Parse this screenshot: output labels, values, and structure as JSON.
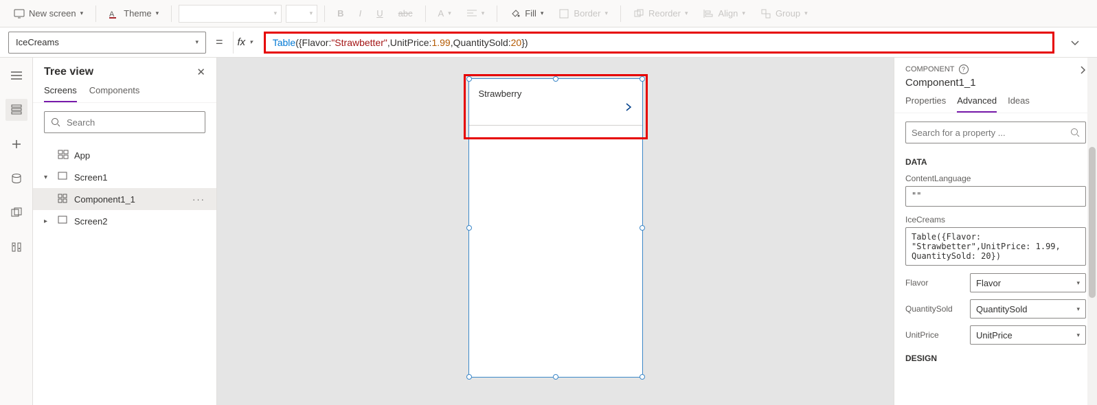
{
  "toolbar": {
    "new_screen": "New screen",
    "theme": "Theme",
    "bold": "B",
    "italic": "I",
    "underline": "U",
    "strike": "abc",
    "font_color": "A",
    "fill": "Fill",
    "border": "Border",
    "reorder": "Reorder",
    "align": "Align",
    "group": "Group"
  },
  "formula": {
    "property": "IceCreams",
    "fn": "Table",
    "id1": "Flavor",
    "str1": "\"Strawbetter\"",
    "id2": "UnitPrice",
    "num1": "1.99",
    "id3": "QuantitySold",
    "num2": "20"
  },
  "tree": {
    "title": "Tree view",
    "tab_screens": "Screens",
    "tab_components": "Components",
    "search_ph": "Search",
    "app": "App",
    "screen1": "Screen1",
    "component1": "Component1_1",
    "screen2": "Screen2"
  },
  "canvas": {
    "item_text": "Strawberry"
  },
  "right": {
    "type": "COMPONENT",
    "name": "Component1_1",
    "tab_props": "Properties",
    "tab_adv": "Advanced",
    "tab_ideas": "Ideas",
    "search_ph": "Search for a property ...",
    "section_data": "DATA",
    "content_lang_lbl": "ContentLanguage",
    "content_lang_val": "\"\"",
    "icecreams_lbl": "IceCreams",
    "icecreams_val": "Table({Flavor: \"Strawbetter\",UnitPrice: 1.99, QuantitySold: 20})",
    "flavor_lbl": "Flavor",
    "flavor_val": "Flavor",
    "qty_lbl": "QuantitySold",
    "qty_val": "QuantitySold",
    "price_lbl": "UnitPrice",
    "price_val": "UnitPrice",
    "section_design": "DESIGN"
  }
}
